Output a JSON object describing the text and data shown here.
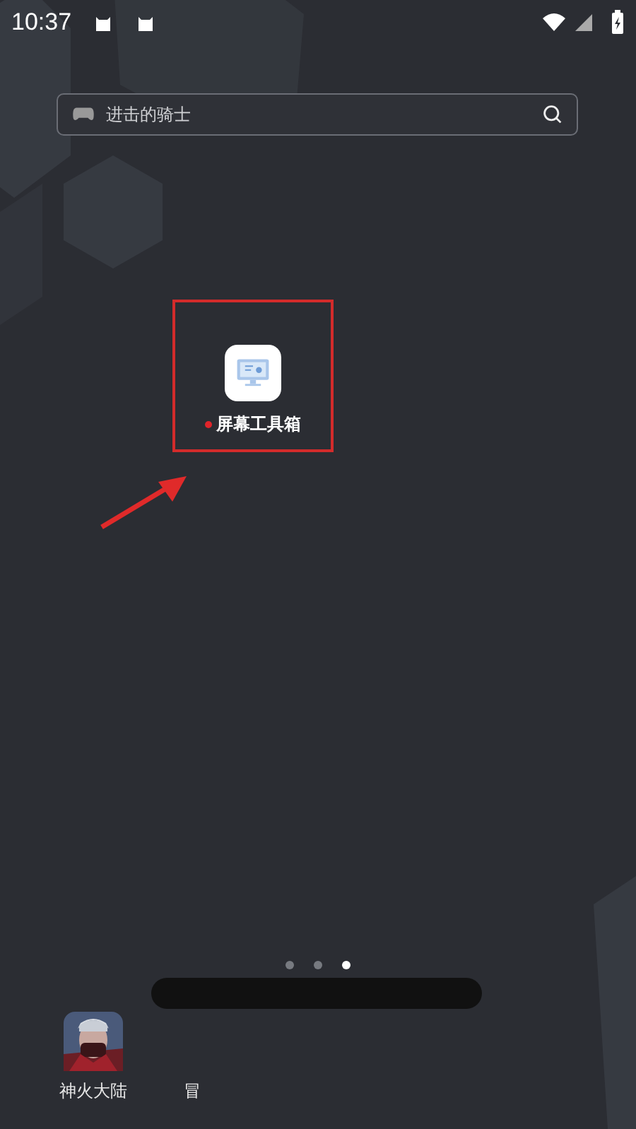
{
  "status_bar": {
    "time": "10:37"
  },
  "search": {
    "placeholder": "进击的骑士"
  },
  "apps": [
    {
      "label": "屏幕工具箱",
      "new": true,
      "highlighted": true
    }
  ],
  "page_dots": [
    {
      "selected": false
    },
    {
      "selected": false
    },
    {
      "selected": true
    }
  ],
  "dock": [
    {
      "label": "神火大陆",
      "kind": "picture"
    },
    {
      "label": "冒",
      "kind": "cut"
    }
  ]
}
